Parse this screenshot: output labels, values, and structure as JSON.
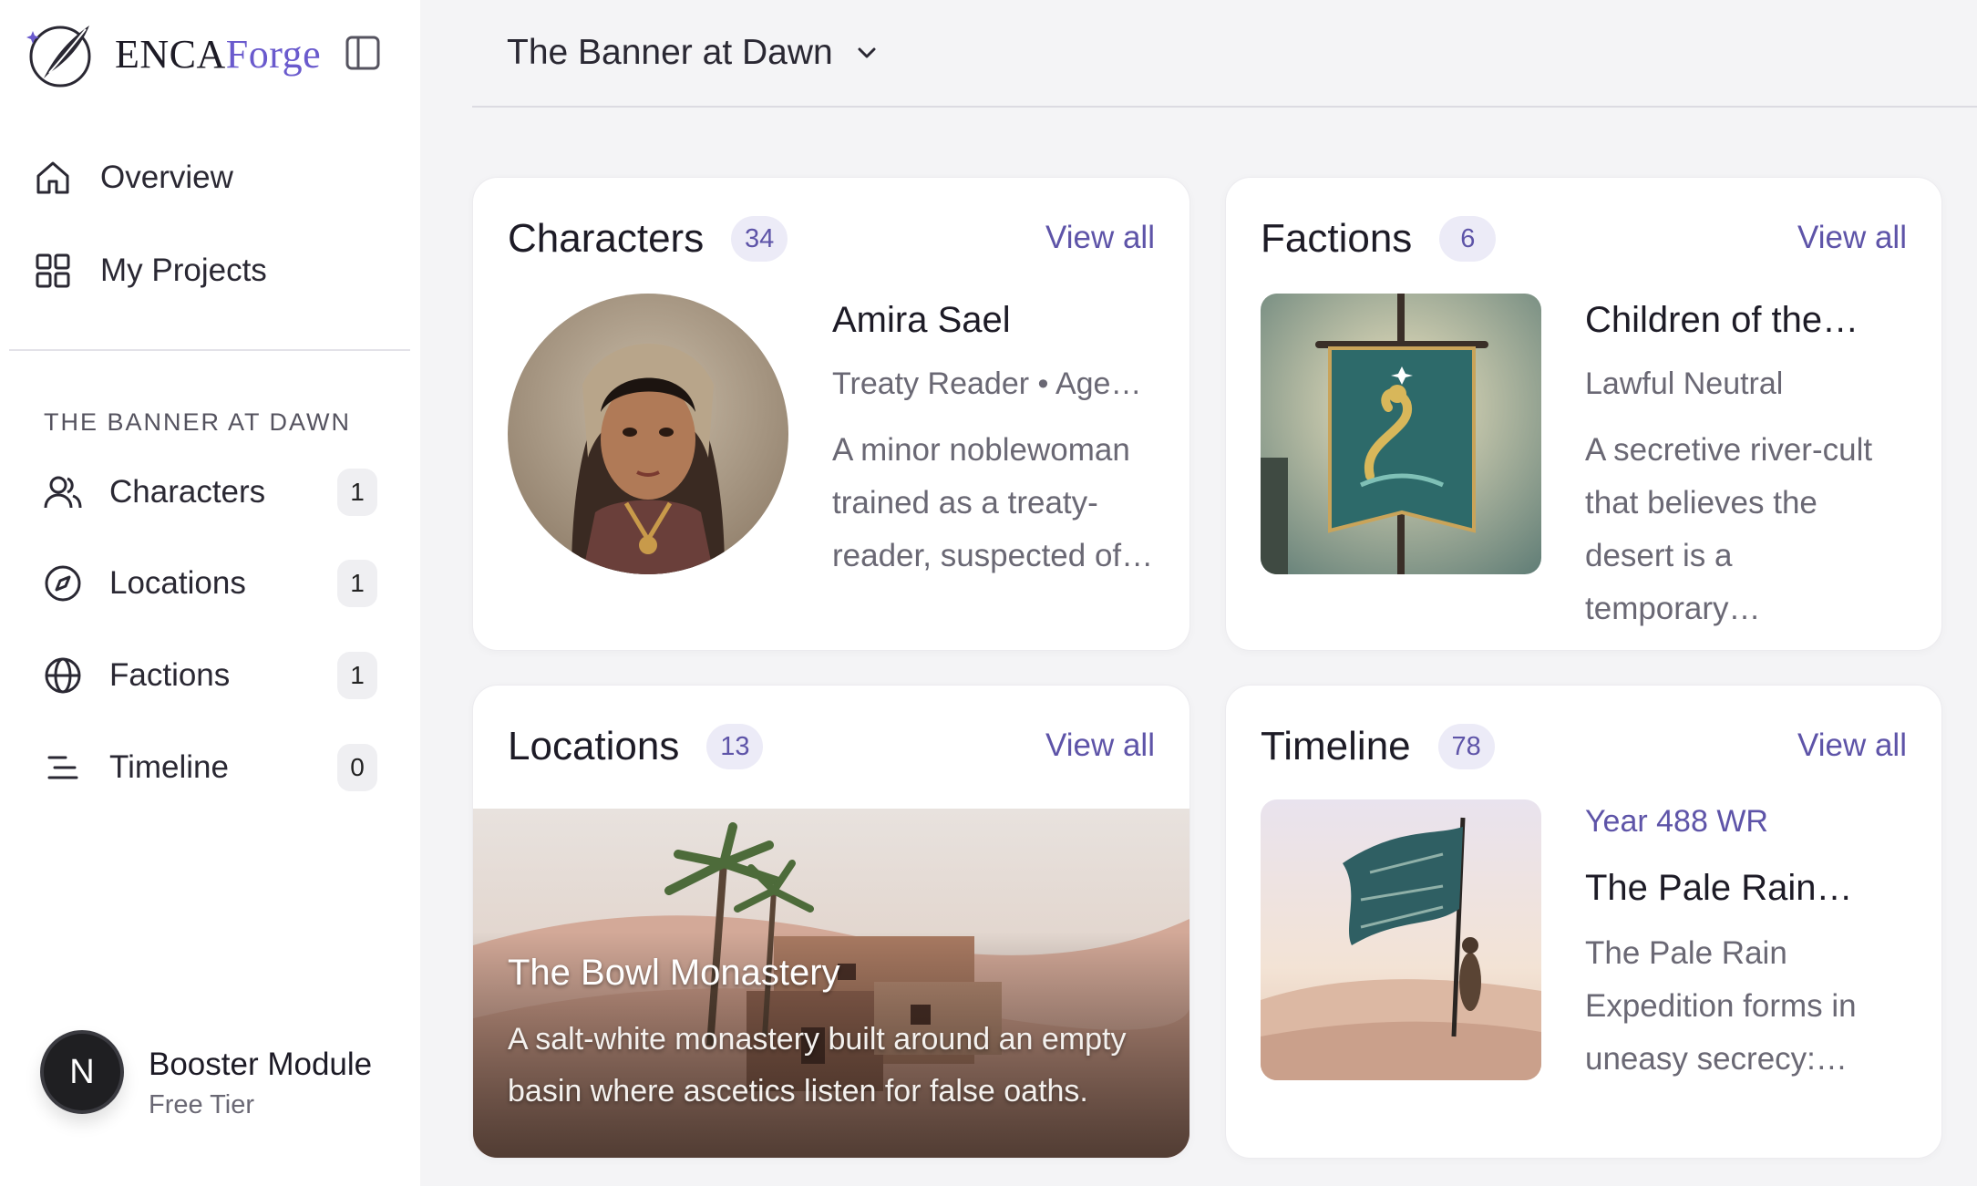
{
  "brand": {
    "part1": "ENCA",
    "part2": "Forge"
  },
  "nav": [
    {
      "label": "Overview",
      "icon": "home-icon"
    },
    {
      "label": "My Projects",
      "icon": "grid-icon"
    }
  ],
  "project_section": {
    "label": "THE BANNER AT DAWN",
    "items": [
      {
        "label": "Characters",
        "count": "1",
        "icon": "users-icon"
      },
      {
        "label": "Locations",
        "count": "1",
        "icon": "compass-icon"
      },
      {
        "label": "Factions",
        "count": "1",
        "icon": "globe-icon"
      },
      {
        "label": "Timeline",
        "count": "0",
        "icon": "list-icon"
      }
    ]
  },
  "user": {
    "initial": "N",
    "name": "Booster Module",
    "tier": "Free Tier"
  },
  "header": {
    "project_title": "The Banner at Dawn"
  },
  "cards": {
    "characters": {
      "title": "Characters",
      "count": "34",
      "view_all": "View all",
      "item": {
        "name": "Amira Sael",
        "subtitle": "Treaty Reader • Age…",
        "description": "A minor noblewoman trained as a treaty-reader, suspected of…"
      }
    },
    "factions": {
      "title": "Factions",
      "count": "6",
      "view_all": "View all",
      "item": {
        "name": "Children of the…",
        "subtitle": "Lawful Neutral",
        "description": "A secretive river-cult that believes the desert is a temporary…"
      }
    },
    "locations": {
      "title": "Locations",
      "count": "13",
      "view_all": "View all",
      "item": {
        "name": "The Bowl Monastery",
        "description": "A salt-white monastery built around an empty basin where ascetics listen for false oaths."
      }
    },
    "timeline": {
      "title": "Timeline",
      "count": "78",
      "view_all": "View all",
      "item": {
        "year": "Year 488 WR",
        "name": "The Pale Rain…",
        "description": "The Pale Rain Expedition forms in uneasy secrecy:…"
      }
    }
  },
  "colors": {
    "accent": "#5e54a8",
    "background": "#f4f4f6",
    "card": "#ffffff"
  }
}
